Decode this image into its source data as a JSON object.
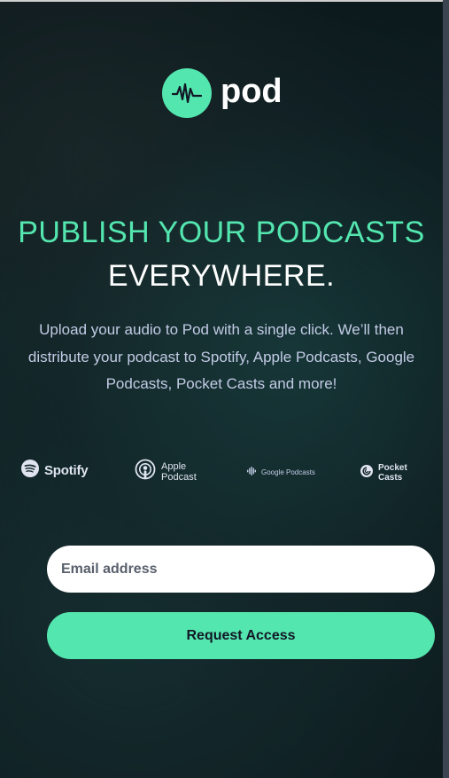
{
  "brand": {
    "name": "pod",
    "accent_color": "#54e6af",
    "background_color": "#121725"
  },
  "hero": {
    "headline_line1": "PUBLISH YOUR PODCASTS",
    "headline_line2": "EVERYWHERE.",
    "description": "Upload your audio to Pod with a single click. We’ll then distribute your podcast to Spotify, Apple Podcasts, Google Podcasts, Pocket Casts and more!"
  },
  "platforms": [
    {
      "label": "Spotify",
      "icon": "spotify-icon"
    },
    {
      "label_line1": "Apple",
      "label_line2": "Podcast",
      "icon": "apple-podcasts-icon"
    },
    {
      "label": "Google Podcasts",
      "icon": "google-podcasts-icon"
    },
    {
      "label": "Pocket Casts",
      "icon": "pocket-casts-icon"
    }
  ],
  "form": {
    "email_placeholder": "Email address",
    "email_value": "",
    "submit_label": "Request Access"
  }
}
